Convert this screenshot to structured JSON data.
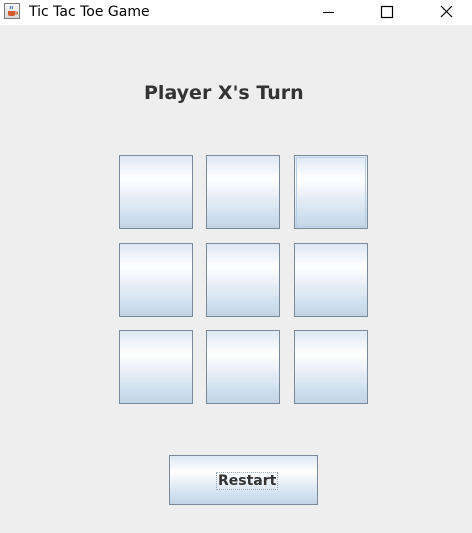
{
  "window": {
    "title": "Tic Tac Toe Game",
    "app_icon": "java-coffee-cup-icon",
    "controls": {
      "minimize_icon": "minimize-icon",
      "maximize_icon": "maximize-icon",
      "close_icon": "close-icon"
    }
  },
  "game": {
    "status": "Player X's Turn",
    "board": [
      [
        "",
        "",
        ""
      ],
      [
        "",
        "",
        ""
      ],
      [
        "",
        "",
        ""
      ]
    ],
    "focused_cell": "row 1, column 3"
  },
  "controls": {
    "restart_label": "Restart"
  }
}
